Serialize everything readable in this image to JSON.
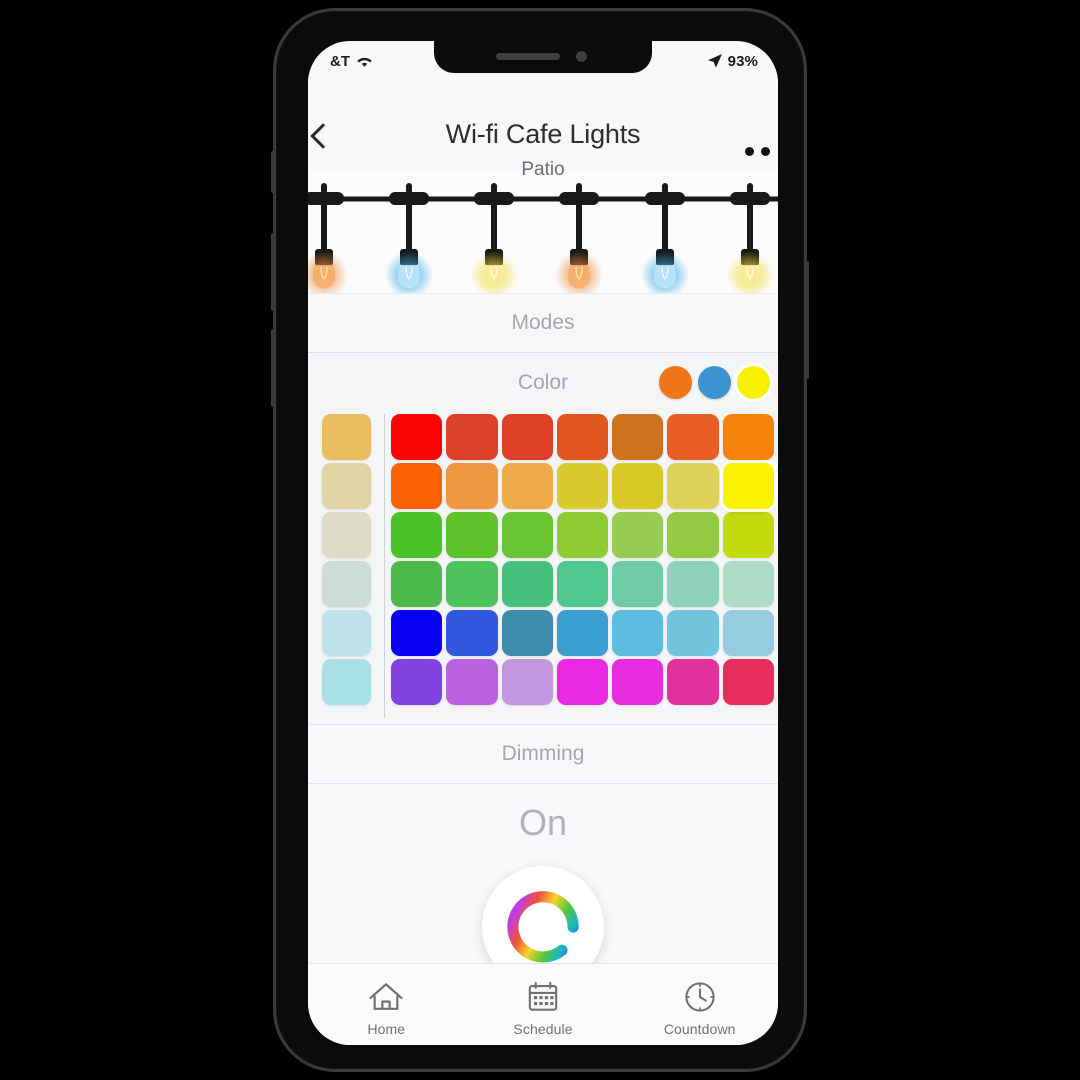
{
  "status_bar": {
    "carrier": "&T",
    "wifi_icon": "wifi-icon",
    "location_icon": "location-arrow-icon",
    "battery_percent": "93%"
  },
  "nav": {
    "back_icon": "chevron-left-icon",
    "title": "Wi-fi Cafe Lights",
    "subtitle": "Patio",
    "more_icon": "more-horizontal-icon"
  },
  "hero": {
    "name": "string-lights-illustration",
    "bulb_count": 6,
    "bulb_colors": [
      "#F08A3C",
      "#35A8E0",
      "#F2DD43",
      "#F08A3C",
      "#35A8E0",
      "#F2DD43"
    ],
    "cord_color": "#1b1b1b"
  },
  "modes": {
    "label": "Modes"
  },
  "color": {
    "label": "Color",
    "active_dots": [
      {
        "name": "color-dot-orange",
        "hex": "#EE7519",
        "selected": false
      },
      {
        "name": "color-dot-blue",
        "hex": "#3D92D1",
        "selected": false
      },
      {
        "name": "color-dot-yellow",
        "hex": "#F7F100",
        "selected": true
      }
    ],
    "white_column": [
      "#E8BC5F",
      "#E2D3A2",
      "#DEDCC6",
      "#CEDCD6",
      "#BDE2EC",
      "#A9E0E8"
    ],
    "grid_rows": [
      [
        "#FB0303",
        "#DC402A",
        "#DF3F24",
        "#E1561F",
        "#CE7220",
        "#E75F22",
        "#F4820B"
      ],
      [
        "#FB6201",
        "#EF9743",
        "#F0AB49",
        "#D9CB2C",
        "#D9C926",
        "#DDD15A",
        "#FBF200"
      ],
      [
        "#49C328",
        "#5FC12C",
        "#6AC434",
        "#8ECC33",
        "#96CC52",
        "#92CB41",
        "#C3DB0C"
      ],
      [
        "#4CBA4A",
        "#4EC25B",
        "#47C07B",
        "#4FC890",
        "#6FCCA7",
        "#8FD2BC",
        "#ACDCC8"
      ],
      [
        "#0800F3",
        "#3057DE",
        "#3C8DAC",
        "#3B9FD2",
        "#5CBDDF",
        "#72C4DE",
        "#97CBE0"
      ],
      [
        "#8242E2",
        "#BB62E0",
        "#C396DF",
        "#EA29E4",
        "#E62BE0",
        "#E0319C",
        "#E62D5C"
      ]
    ],
    "selected_cell": {
      "row": 1,
      "col": 6
    }
  },
  "dimming": {
    "label": "Dimming"
  },
  "power": {
    "state_label": "On",
    "button_icon": "enbrighten-e-logo-icon"
  },
  "tabs": [
    {
      "label": "Home",
      "icon": "home-icon",
      "name": "tab-home"
    },
    {
      "label": "Schedule",
      "icon": "calendar-icon",
      "name": "tab-schedule"
    },
    {
      "label": "Countdown",
      "icon": "clock-icon",
      "name": "tab-countdown"
    }
  ]
}
